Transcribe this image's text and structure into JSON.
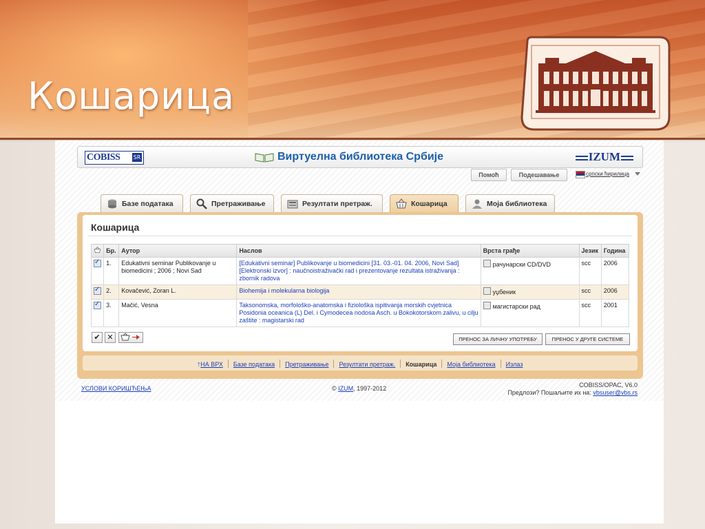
{
  "slide": {
    "title": "Кошарица"
  },
  "header": {
    "cobiss_logo": "COBISS",
    "cobiss_suffix": "SR",
    "app_title": "Виртуелна библиотека Србије",
    "izum_logo": "IZUM"
  },
  "toolbar": {
    "help": "Помоћ",
    "settings": "Подешавање",
    "language": "српски ћирилица"
  },
  "tabs": [
    {
      "label": "Базе података",
      "icon": "database-icon",
      "active": false
    },
    {
      "label": "Претраживање",
      "icon": "magnifier-icon",
      "active": false
    },
    {
      "label": "Резултати претраж.",
      "icon": "results-icon",
      "active": false
    },
    {
      "label": "Кошарица",
      "icon": "basket-icon",
      "active": true
    },
    {
      "label": "Моја библиотека",
      "icon": "user-icon",
      "active": false
    }
  ],
  "panel": {
    "title": "Кошарица"
  },
  "table": {
    "columns": [
      "Бр.",
      "Аутор",
      "Наслов",
      "Врста грађе",
      "Језик",
      "Година"
    ],
    "rows": [
      {
        "num": "1.",
        "author": "Edukativni seminar Publikovanje u biomedicini ; 2006 ; Novi Sad",
        "title": "[Edukativni seminar] Publikovanje u biomedicini [31. 03.-01. 04. 2006, Novi Sad] [Elektronski izvor] : naučnoistraživački rad i prezentovanje rezultata istraživanja : zbornik radova",
        "type": "рачунарски CD/DVD",
        "lang": "scc",
        "year": "2006",
        "checked": true
      },
      {
        "num": "2.",
        "author": "Kovačević, Zoran L.",
        "title": "Biohemija i molekularna biologija",
        "type": "уџбеник",
        "lang": "scc",
        "year": "2006",
        "checked": true
      },
      {
        "num": "3.",
        "author": "Mačić, Vesna",
        "title": "Taksonomska, morfološko-anatomska i fiziološka ispitivanja morskih cvjetnica Posidonia oceanica (L) Del. i Cymodecea nodosa Asch. u Bokokotorskom zalivu, u cilju zaštite : magistarski rad",
        "type": "магистарски рад",
        "lang": "scc",
        "year": "2001",
        "checked": true
      }
    ]
  },
  "actions": {
    "transfer_personal": "ПРЕНОС ЗА ЛИЧНУ УПОТРЕБУ",
    "transfer_other": "ПРЕНОС У ДРУГЕ СИСТЕМЕ"
  },
  "nav": {
    "top": "НА ВРХ",
    "items": [
      "Базе података",
      "Претраживање",
      "Резултати претраж.",
      "Кошарица",
      "Моја библиотека",
      "Излаз"
    ]
  },
  "footer": {
    "terms": "УСЛОВИ КОРИШЋЕЊА",
    "copyright_prefix": "©",
    "copyright_link": "IZUM",
    "copyright_years": ", 1997-2012",
    "version": "COBISS/OPAC, V6.0",
    "suggest_text": "Предлози? Пошаљите их на:",
    "suggest_email": "vbsuser@vbs.rs"
  },
  "colors": {
    "banner": "#d5683a",
    "link": "#1b3fb8",
    "panel_frame": "#ecc591",
    "row_highlight": "#f9efdf"
  }
}
